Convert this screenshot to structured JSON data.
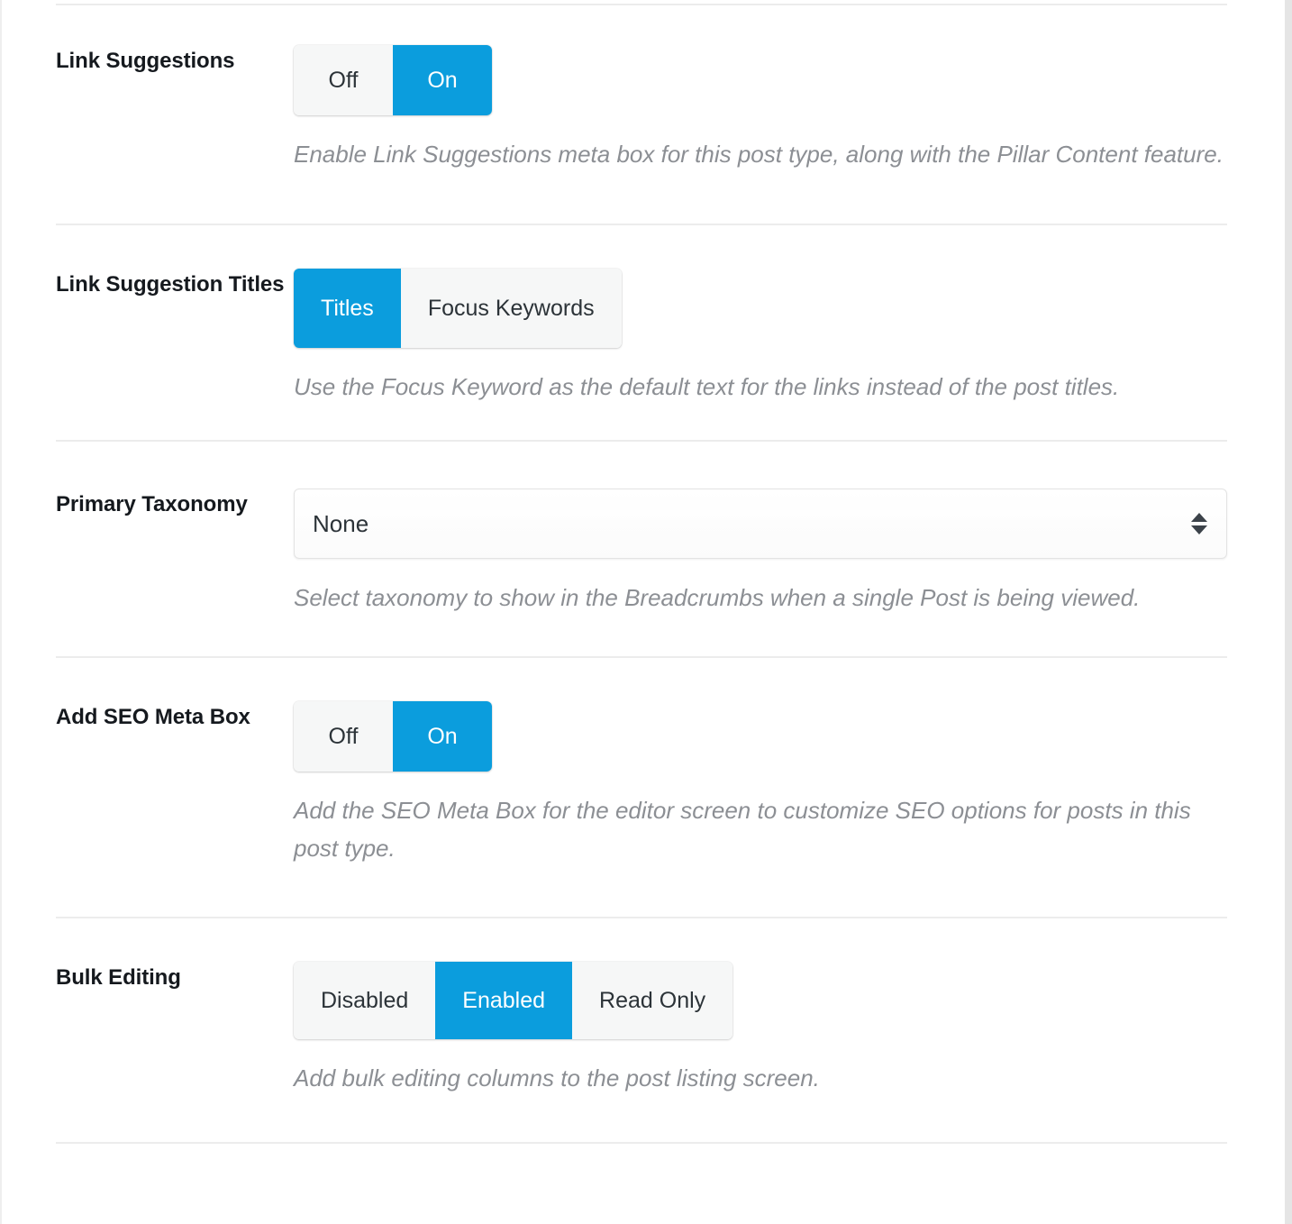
{
  "theme": {
    "accent": "#0b9ddd",
    "label_color": "#15191e",
    "description_color": "#8c8f94",
    "control_bg": "#f6f7f7",
    "divider": "#ececec"
  },
  "settings": {
    "rows": [
      {
        "id": "link-suggestions",
        "label": "Link Suggestions",
        "control": "toggle",
        "options": [
          "Off",
          "On"
        ],
        "selected": "On",
        "description": "Enable Link Suggestions meta box for this post type, along with the Pillar Content feature."
      },
      {
        "id": "link-suggestion-titles",
        "label": "Link Suggestion Titles",
        "control": "segmented",
        "options": [
          "Titles",
          "Focus Keywords"
        ],
        "selected": "Titles",
        "description": "Use the Focus Keyword as the default text for the links instead of the post titles."
      },
      {
        "id": "primary-taxonomy",
        "label": "Primary Taxonomy",
        "control": "select",
        "value": "None",
        "description": "Select taxonomy to show in the Breadcrumbs when a single Post is being viewed."
      },
      {
        "id": "add-seo-meta-box",
        "label": "Add SEO Meta Box",
        "control": "toggle",
        "options": [
          "Off",
          "On"
        ],
        "selected": "On",
        "description": "Add the SEO Meta Box for the editor screen to customize SEO options for posts in this post type."
      },
      {
        "id": "bulk-editing",
        "label": "Bulk Editing",
        "control": "segmented",
        "options": [
          "Disabled",
          "Enabled",
          "Read Only"
        ],
        "selected": "Enabled",
        "description": "Add bulk editing columns to the post listing screen."
      }
    ]
  }
}
